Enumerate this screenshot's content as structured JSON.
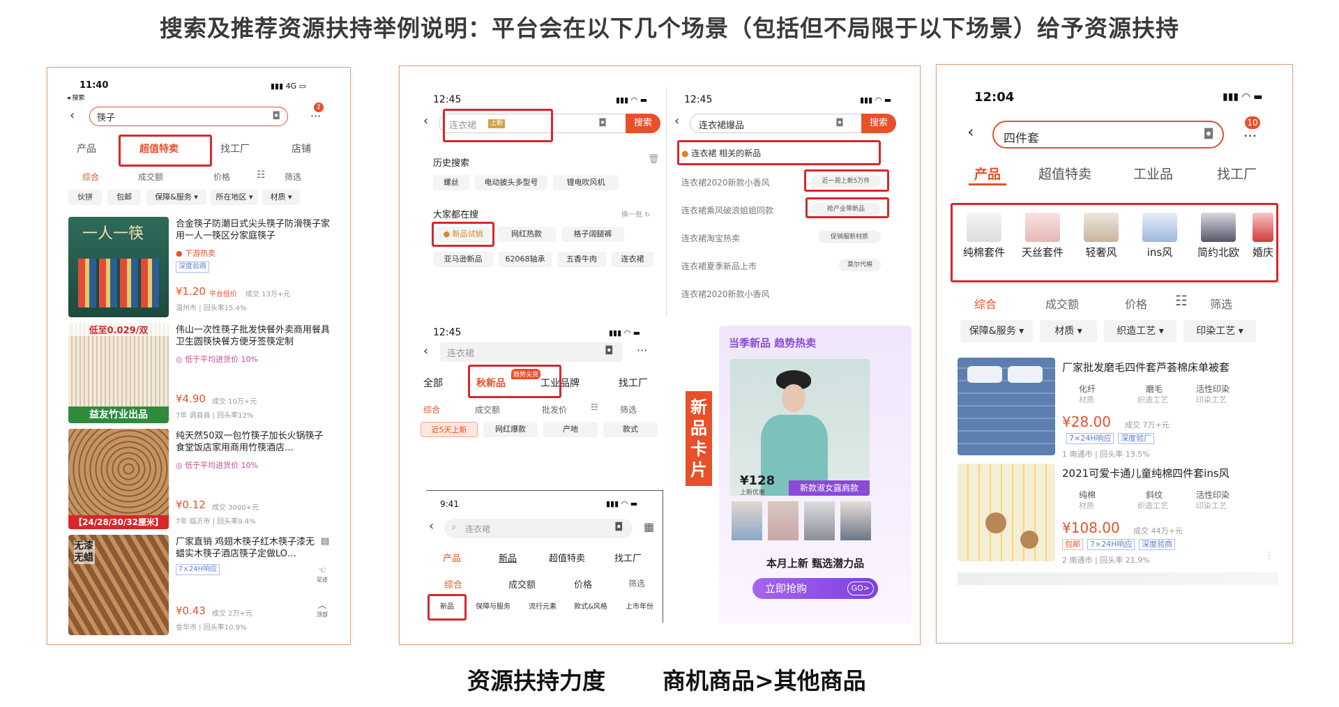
{
  "title": "搜索及推荐资源扶持举例说明：平台会在以下几个场景（包括但不局限于以下场景）给予资源扶持",
  "footer": {
    "left": "资源扶持力度",
    "right": "商机商品>其他商品"
  },
  "colors": {
    "accent": "#e8502a",
    "highlight": "#d9262b",
    "panel_border": "#e2a07a"
  },
  "p1": {
    "time": "11:40",
    "back_label": "◂ 搜索",
    "network": "4G",
    "search_value": "筷子",
    "badge": "2",
    "tabs": [
      "产品",
      "超值特卖",
      "找工厂",
      "店铺"
    ],
    "sort": [
      "综合",
      "成交额",
      "价格",
      "筛选"
    ],
    "chips": [
      "伙拼",
      "包邮",
      "保障&服务 ▾",
      "所在地区 ▾",
      "材质 ▾"
    ],
    "items": [
      {
        "img_text": "一人一筷",
        "title": "合金筷子防潮日式尖头筷子防滑筷子家用一人一筷区分家庭筷子",
        "tag": "下游热卖",
        "tag2": "深度验商",
        "price": "¥1.20",
        "price_note": "平台低价",
        "sales": "成交 13万+元",
        "meta": "温州市 | 回头率15.4%"
      },
      {
        "img_text": "低至0.029/双",
        "img_text2": "益友竹业出品",
        "title": "伟山一次性筷子批发快餐外卖商用餐具卫生圆筷快餐方便牙签筷定制",
        "tag": "低于平均进货价 10%",
        "price": "¥4.90",
        "sales": "成交 10万+元",
        "meta": "7年 调县县 | 回头率12%"
      },
      {
        "img_text": "【24/28/30/32厘米】",
        "title": "纯天然50双一包竹筷子加长火锅筷子食堂饭店家用商用竹筷酒店…",
        "tag": "低于平均进货价 10%",
        "price": "¥0.12",
        "sales": "成交 3000+元",
        "meta": "7年 临沂市 | 回头率9.4%"
      },
      {
        "img_text": "无漆无蜡",
        "title": "厂家直销 鸡翅木筷子红木筷子漆无蜡实木筷子酒店筷子定做LO…",
        "tag": "7×24H响应",
        "price": "¥0.43",
        "sales": "成交 2万+元",
        "meta": "金华市 | 回头率10.9%"
      }
    ],
    "side_labels": [
      "足迹",
      "顶部"
    ]
  },
  "p2": {
    "a": {
      "time": "12:45",
      "placeholder": "连衣裙",
      "new_tag": "上新",
      "search_btn": "搜索",
      "history_title": "历史搜索",
      "history": [
        "螺丝",
        "电动披头多型号",
        "锂电吹风机"
      ],
      "hot_title": "大家都在搜",
      "hot_refresh": "换一批",
      "hot": [
        "新品试销",
        "网红热款",
        "格子阔腿裤",
        "亚马逊新品",
        "62068轴承",
        "五香牛肉",
        "连衣裙"
      ]
    },
    "b": {
      "time": "12:45",
      "value": "连衣裙爆品",
      "search_btn": "搜索",
      "suggest": "连衣裙 相关的新品",
      "rows": [
        {
          "text": "连衣裙2020新款小香风",
          "badge": "近一周上新5万件"
        },
        {
          "text": "连衣裙乘风破浪姐姐同款",
          "badge": "抢产业带新品"
        },
        {
          "text": "连衣裙淘宝热卖",
          "badge": "促销服新材质"
        },
        {
          "text": "连衣裙夏季新品上市",
          "badge": "莫尔代棉"
        },
        {
          "text": "连衣裙2020新款小香风",
          "badge": ""
        }
      ]
    },
    "c": {
      "time": "12:45",
      "placeholder": "连衣裙",
      "tabs": [
        "全部",
        "秋新品",
        "工业品牌",
        "找工厂"
      ],
      "trend_tag": "趋势尖货",
      "sort": [
        "综合",
        "成交额",
        "批发价",
        "筛选"
      ],
      "chips": [
        "近5天上新",
        "网红爆款",
        "产地",
        "款式"
      ]
    },
    "d": {
      "time": "9:41",
      "placeholder": "连衣裙",
      "tabs": [
        "产品",
        "新品",
        "超值特卖",
        "找工厂"
      ],
      "sort": [
        "综合",
        "成交额",
        "价格",
        "筛选"
      ],
      "chips": [
        "新品",
        "保障与服务",
        "流行元素",
        "款式&风格",
        "上市年份"
      ]
    },
    "card_label": "新品卡片",
    "card": {
      "head": "当季新品 趋势热卖",
      "price": "¥128",
      "price_note": "上新优惠",
      "style": "新款淑女露肩款",
      "subtitle": "本月上新 甄选潜力品",
      "cta": "立即抢购",
      "go": "GO>"
    }
  },
  "p3": {
    "time": "12:04",
    "search_value": "四件套",
    "badge": "10",
    "tabs": [
      "产品",
      "超值特卖",
      "工业品",
      "找工厂"
    ],
    "cats": [
      "纯棉套件",
      "天丝套件",
      "轻奢风",
      "ins风",
      "简约北欧",
      "婚庆"
    ],
    "sort": [
      "综合",
      "成交额",
      "价格",
      "筛选"
    ],
    "chips": [
      "保障&服务 ▾",
      "材质 ▾",
      "织造工艺 ▾",
      "印染工艺 ▾"
    ],
    "items": [
      {
        "title": "厂家批发磨毛四件套芦荟棉床单被套",
        "attrs": [
          [
            "化纤",
            "材质"
          ],
          [
            "磨毛",
            "织造工艺"
          ],
          [
            "活性印染",
            "印染工艺"
          ]
        ],
        "price": "¥28.00",
        "sales": "成交 7万+元",
        "tags": [
          "7×24H响应",
          "深度验厂"
        ],
        "meta": "1 南通市 | 回头率 13.5%"
      },
      {
        "title": "2021可爱卡通儿童纯棉四件套ins风",
        "attrs": [
          [
            "纯棉",
            "材质"
          ],
          [
            "斜纹",
            "织造工艺"
          ],
          [
            "活性印染",
            "印染工艺"
          ]
        ],
        "price": "¥108.00",
        "sales": "成交 44万+元",
        "tags": [
          "包邮",
          "7×24H响应",
          "深度验商"
        ],
        "meta": "2 南通市 | 回头率 21.9%"
      }
    ]
  }
}
